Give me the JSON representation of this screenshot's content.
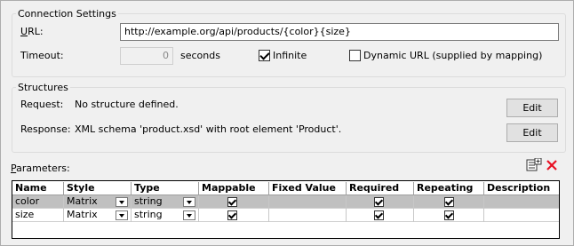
{
  "connection": {
    "title": "Connection Settings",
    "url_label": "URL:",
    "url_value": "http://example.org/api/products/{color}{size}",
    "timeout_label": "Timeout:",
    "timeout_value": "0",
    "seconds_label": "seconds",
    "infinite_label": "Infinite",
    "infinite_checked": true,
    "dynamic_label": "Dynamic URL (supplied by mapping)",
    "dynamic_checked": false
  },
  "structures": {
    "title": "Structures",
    "request_label": "Request:",
    "request_value": "No structure defined.",
    "response_label": "Response:",
    "response_value": "XML schema 'product.xsd' with root element 'Product'.",
    "edit_label": "Edit"
  },
  "parameters": {
    "label": "Parameters:",
    "add_icon": "add-parameter-icon",
    "delete_icon": "delete-icon",
    "delete_color": "#e81123",
    "headers": [
      "Name",
      "Style",
      "Type",
      "Mappable",
      "Fixed Value",
      "Required",
      "Repeating",
      "Description"
    ],
    "rows": [
      {
        "name": "color",
        "style": "Matrix",
        "type": "string",
        "mappable": true,
        "fixed_value": "",
        "required": true,
        "repeating": true,
        "description": "",
        "selected": true
      },
      {
        "name": "size",
        "style": "Matrix",
        "type": "string",
        "mappable": true,
        "fixed_value": "",
        "required": true,
        "repeating": true,
        "description": "",
        "selected": false
      }
    ]
  },
  "colors": {
    "selected_row": "#c0c0c0",
    "background": "#f0f0f0"
  }
}
